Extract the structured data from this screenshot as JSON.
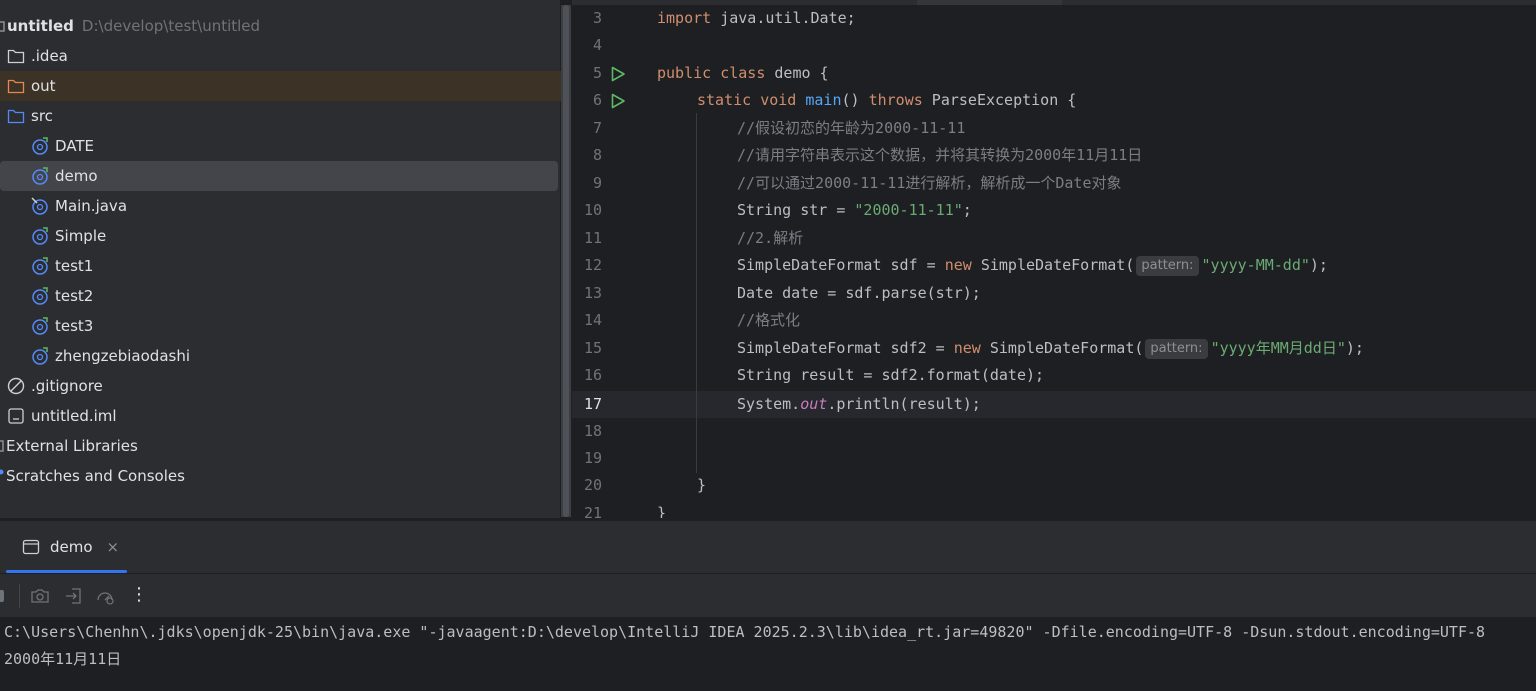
{
  "project": {
    "root_name": "untitled",
    "root_path": "D:\\develop\\test\\untitled",
    "items": [
      {
        "label": ".idea"
      },
      {
        "label": "out"
      },
      {
        "label": "src"
      },
      {
        "label": "DATE"
      },
      {
        "label": "demo"
      },
      {
        "label": "Main.java"
      },
      {
        "label": "Simple"
      },
      {
        "label": "test1"
      },
      {
        "label": "test2"
      },
      {
        "label": "test3"
      },
      {
        "label": "zhengzebiaodashi"
      },
      {
        "label": ".gitignore"
      },
      {
        "label": "untitled.iml"
      },
      {
        "label": "External Libraries"
      },
      {
        "label": "Scratches and Consoles"
      }
    ]
  },
  "editor": {
    "line_numbers": [
      "3",
      "4",
      "5",
      "6",
      "7",
      "8",
      "9",
      "10",
      "11",
      "12",
      "13",
      "14",
      "15",
      "16",
      "17",
      "18",
      "19",
      "20",
      "21"
    ],
    "current_line": "17",
    "code": {
      "l3_kw": "import",
      "l3_rest": " java.util.Date;",
      "l5_kw1": "public",
      "l5_kw2": "class",
      "l5_rest": " demo {",
      "l6_kw1": "static",
      "l6_kw2": "void",
      "l6_fn": "main",
      "l6_mid": "() ",
      "l6_kw3": "throws",
      "l6_rest": " ParseException {",
      "l7": "//假设初恋的年龄为2000-11-11",
      "l8": "//请用字符串表示这个数据，并将其转换为2000年11月11日",
      "l9": "//可以通过2000-11-11进行解析，解析成一个Date对象",
      "l10_a": "String str = ",
      "l10_str": "\"2000-11-11\"",
      "l10_end": ";",
      "l11": "//2.解析",
      "l12_a": "SimpleDateFormat sdf = ",
      "l12_kw": "new",
      "l12_b": " SimpleDateFormat(",
      "l12_hint": "pattern:",
      "l12_str": "\"yyyy-MM-dd\"",
      "l12_end": ");",
      "l13": "Date date = sdf.parse(str);",
      "l14": "//格式化",
      "l15_a": "SimpleDateFormat sdf2 = ",
      "l15_kw": "new",
      "l15_b": " SimpleDateFormat(",
      "l15_hint": "pattern:",
      "l15_str": "\"yyyy年MM月dd日\"",
      "l15_end": ");",
      "l16": "String result = sdf2.format(date);",
      "l17_a": "System.",
      "l17_fld": "out",
      "l17_b": ".println(result);",
      "l20": "}",
      "l21": "}"
    }
  },
  "run": {
    "tab_label": "demo",
    "tab_close": "×",
    "more_label": "⋮",
    "console": [
      "C:\\Users\\Chenhn\\.jdks\\openjdk-25\\bin\\java.exe \"-javaagent:D:\\develop\\IntelliJ IDEA 2025.2.3\\lib\\idea_rt.jar=49820\" -Dfile.encoding=UTF-8 -Dsun.stdout.encoding=UTF-8",
      "2000年11月11日"
    ]
  },
  "colors": {
    "keyword": "#cf8e6d",
    "function": "#56a8f5",
    "string": "#6aab73",
    "comment": "#7a7e85",
    "static_field": "#c77dbb",
    "accent": "#3574f0",
    "run_icon": "#5fb865"
  },
  "icons": {
    "folder": "folder-icon",
    "excluded_folder": "excluded-folder-icon",
    "source_folder": "source-folder-icon",
    "java_class": "java-class-icon",
    "gitignore": "ignore-file-icon",
    "module_file": "module-file-icon",
    "run_gutter": "run-icon"
  }
}
